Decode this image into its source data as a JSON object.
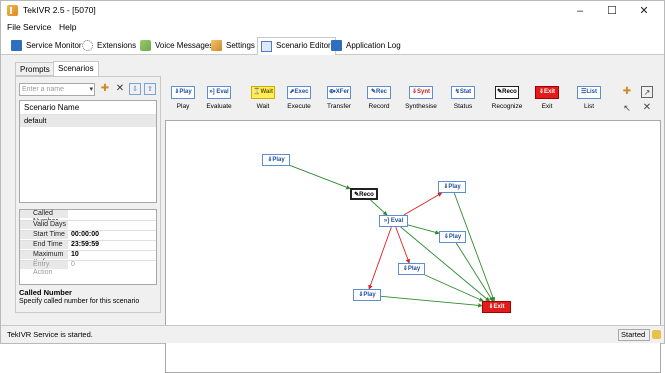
{
  "window": {
    "title": "TekIVR 2.5 - [5070]",
    "min_glyph": "–",
    "max_glyph": "☐",
    "close_glyph": "✕"
  },
  "menu": [
    "File",
    "Service",
    "Help"
  ],
  "main_tabs": [
    {
      "label": "Service Monitor",
      "icon": "monitor-icon",
      "color": "#2f6fbf"
    },
    {
      "label": "Extensions",
      "icon": "extensions-icon",
      "color": "#8a8a8a"
    },
    {
      "label": "Voice Messages",
      "icon": "voice-messages-icon",
      "color": "#6aa84f"
    },
    {
      "label": "Settings",
      "icon": "settings-icon",
      "color": "#d08a2a"
    },
    {
      "label": "Scenario Editor",
      "icon": "scenario-editor-icon",
      "color": "#4a7ec8",
      "active": true
    },
    {
      "label": "Application Log",
      "icon": "application-log-icon",
      "color": "#2f6fbf"
    }
  ],
  "sub_tabs": [
    {
      "label": "Prompts",
      "active": false
    },
    {
      "label": "Scenarios",
      "active": true
    }
  ],
  "scenario_panel": {
    "search_placeholder": "Enter a name",
    "list_header": "Scenario Name",
    "scenarios": [
      "default"
    ],
    "properties": [
      {
        "key": "Called Number",
        "value": "",
        "category": true
      },
      {
        "key": "Valid Days",
        "value": ""
      },
      {
        "key": "Start Time",
        "value": "00:00:00"
      },
      {
        "key": "End Time",
        "value": "23:59:59"
      },
      {
        "key": "Maximum # of",
        "value": "10"
      },
      {
        "key": "Entry Action",
        "value": "0",
        "dim": true
      }
    ],
    "description_title": "Called Number",
    "description_text": "Specify called number for this scenario"
  },
  "toolbar": [
    {
      "name": "play",
      "glyph": "⇓Play",
      "label": "Play",
      "color": "#1f4f9f",
      "border": "#5b8fd1",
      "bg": "#ffffff"
    },
    {
      "name": "evaluate",
      "glyph": "»] Eval",
      "label": "Evaluate",
      "color": "#1f4f9f",
      "border": "#5b8fd1",
      "bg": "#ffffff"
    },
    {
      "name": "wait",
      "glyph": "⌛Wait",
      "label": "Wait",
      "color": "#6b5500",
      "border": "#c9b000",
      "bg": "#ffee55"
    },
    {
      "name": "execute",
      "glyph": "⬈Exec",
      "label": "Execute",
      "color": "#1f4f9f",
      "border": "#5b8fd1",
      "bg": "#ffffff"
    },
    {
      "name": "transfer",
      "glyph": "⟴XFer",
      "label": "Transfer",
      "color": "#1f4f9f",
      "border": "#5b8fd1",
      "bg": "#ffffff"
    },
    {
      "name": "record",
      "glyph": "✎Rec",
      "label": "Record",
      "color": "#1f4f9f",
      "border": "#5b8fd1",
      "bg": "#ffffff"
    },
    {
      "name": "synthesise",
      "glyph": "⇓Synt",
      "label": "Synthesise",
      "color": "#c01f1f",
      "border": "#5b8fd1",
      "bg": "#ffffff"
    },
    {
      "name": "status",
      "glyph": "↯Stat",
      "label": "Status",
      "color": "#1f4f9f",
      "border": "#5b8fd1",
      "bg": "#ffffff"
    },
    {
      "name": "recognize",
      "glyph": "✎Reco",
      "label": "Recognize",
      "color": "#000000",
      "border": "#222222",
      "bg": "#ffffff"
    },
    {
      "name": "exit",
      "glyph": "⇓Exit",
      "label": "Exit",
      "color": "#ffffff",
      "border": "#a00000",
      "bg": "#e41b1b"
    },
    {
      "name": "list",
      "glyph": "☰List",
      "label": "List",
      "color": "#1f4f9f",
      "border": "#5b8fd1",
      "bg": "#ffffff"
    }
  ],
  "flow_nodes": [
    {
      "id": "play1",
      "text": "⇓Play",
      "color": "#1f4f9f",
      "border": "#5b8fd1",
      "bg": "#ffffff"
    },
    {
      "id": "reco",
      "text": "✎Reco",
      "color": "#000000",
      "border": "#222222",
      "bg": "#ffffff"
    },
    {
      "id": "eval",
      "text": "»] Eval",
      "color": "#1f4f9f",
      "border": "#5b8fd1",
      "bg": "#ffffff"
    },
    {
      "id": "play2",
      "text": "⇓Play",
      "color": "#1f4f9f",
      "border": "#5b8fd1",
      "bg": "#ffffff"
    },
    {
      "id": "play3",
      "text": "⇓Play",
      "color": "#1f4f9f",
      "border": "#5b8fd1",
      "bg": "#ffffff"
    },
    {
      "id": "play4",
      "text": "⇓Play",
      "color": "#1f4f9f",
      "border": "#5b8fd1",
      "bg": "#ffffff"
    },
    {
      "id": "play5",
      "text": "⇓Play",
      "color": "#1f4f9f",
      "border": "#5b8fd1",
      "bg": "#ffffff"
    },
    {
      "id": "exit",
      "text": "⇓Exit",
      "color": "#ffffff",
      "border": "#a00000",
      "bg": "#e41b1b"
    }
  ],
  "flow_edges": [
    {
      "from": "play1",
      "to": "reco",
      "color": "#2e8b2e"
    },
    {
      "from": "reco",
      "to": "eval",
      "color": "#2e8b2e"
    },
    {
      "from": "eval",
      "to": "play2",
      "color": "#2e8b2e"
    },
    {
      "from": "eval",
      "to": "play3",
      "color": "#e02020"
    },
    {
      "from": "eval",
      "to": "play4",
      "color": "#e02020"
    },
    {
      "from": "eval",
      "to": "play5",
      "color": "#e02020"
    },
    {
      "from": "play2",
      "to": "exit",
      "color": "#2e8b2e"
    },
    {
      "from": "play3",
      "to": "exit",
      "color": "#2e8b2e"
    },
    {
      "from": "play4",
      "to": "exit",
      "color": "#2e8b2e"
    },
    {
      "from": "play5",
      "to": "exit",
      "color": "#2e8b2e"
    },
    {
      "from": "eval",
      "to": "exit",
      "color": "#2e8b2e"
    }
  ],
  "status_bar": {
    "text": "TekIVR Service is started.",
    "state": "Started"
  }
}
